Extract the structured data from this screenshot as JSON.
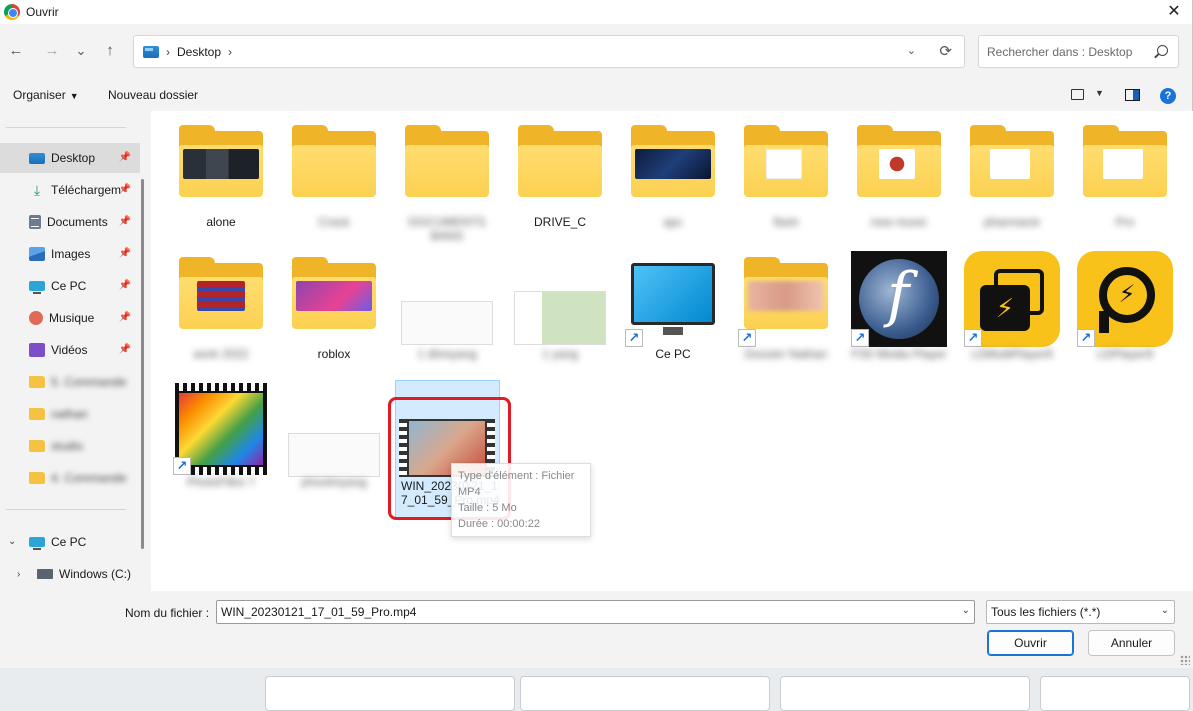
{
  "window": {
    "title": "Ouvrir",
    "close_label": "✕"
  },
  "nav": {
    "back": "←",
    "forward": "→",
    "recent": "⌄",
    "up": "↑",
    "breadcrumb": [
      "Desktop"
    ],
    "refresh": "⟳"
  },
  "search": {
    "placeholder": "Rechercher dans : Desktop"
  },
  "toolbar": {
    "organize": "Organiser",
    "new_folder": "Nouveau dossier",
    "help": "?"
  },
  "sidebar": {
    "items": [
      {
        "label": "Desktop",
        "icon": "desktop-icon"
      },
      {
        "label": "Téléchargem",
        "icon": "download-icon"
      },
      {
        "label": "Documents",
        "icon": "documents-icon"
      },
      {
        "label": "Images",
        "icon": "images-icon"
      },
      {
        "label": "Ce PC",
        "icon": "pc-icon"
      },
      {
        "label": "Musique",
        "icon": "music-icon"
      },
      {
        "label": "Vidéos",
        "icon": "video-icon"
      },
      {
        "label": "5. Commande",
        "icon": "folder-icon"
      },
      {
        "label": "nathan",
        "icon": "folder-icon"
      },
      {
        "label": "studio",
        "icon": "folder-icon"
      },
      {
        "label": "4. Commande",
        "icon": "folder-icon"
      }
    ],
    "tree": [
      {
        "label": "Ce PC"
      },
      {
        "label": "Windows (C:)"
      }
    ]
  },
  "files": {
    "row1": [
      "alone",
      "Crack",
      "DOCUMENTS BANS",
      "DRIVE_C",
      "apc",
      "flash",
      "new music",
      "pharmacie",
      "Pro"
    ],
    "row2": [
      "work 2022",
      "roblox",
      "1 dhmyang",
      "1 yang",
      "Ce PC",
      "Dossier Nathan",
      "FS5 Media Player",
      "LDMultiPlayer9",
      "LDPlayer9"
    ],
    "row3": [
      "PhotoFiltre 7",
      "phoolmyang",
      "WIN_20230121_17_01_59_Pro.mp4"
    ],
    "selected_label_line1": "WIN_20230121_1",
    "selected_label_line2": "7_01_59_Pro.mp4",
    "tooltip_line1": "Type d'élément : Fichier MP4",
    "tooltip_line2": "Taille : 5 Mo",
    "tooltip_line3": "Durée : 00:00:22"
  },
  "footer": {
    "filename_label": "Nom du fichier :",
    "filename_value": "WIN_20230121_17_01_59_Pro.mp4",
    "filter": "Tous les fichiers (*.*)",
    "open": "Ouvrir",
    "cancel": "Annuler"
  },
  "colors": {
    "accent": "#1a73d9",
    "folder": "#f0b429",
    "highlight": "#e01b24"
  }
}
